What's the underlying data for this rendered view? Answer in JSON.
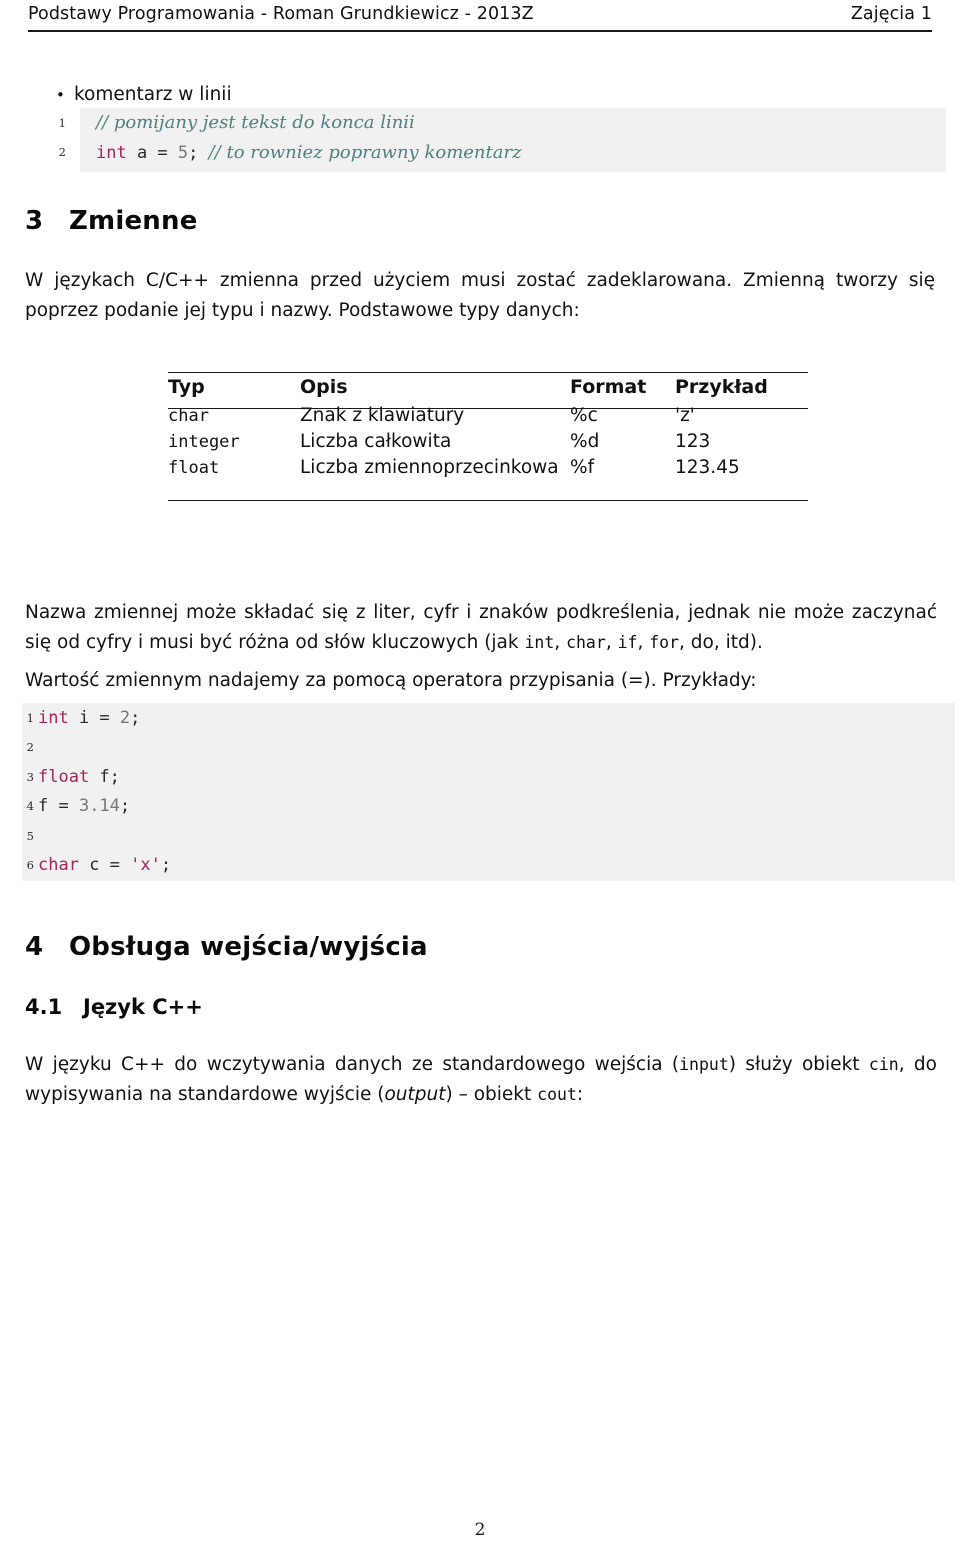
{
  "header": {
    "left": "Podstawy Programowania - Roman Grundkiewicz - 2013Z",
    "right": "Zajęcia 1"
  },
  "bullet": {
    "marker": "•",
    "text": "komentarz w linii"
  },
  "code_comments": {
    "lines": [
      {
        "no": "1",
        "tokens": [
          {
            "t": "// pomijany jest tekst do konca linii",
            "c": "cmt"
          }
        ]
      },
      {
        "no": "2",
        "tokens": [
          {
            "t": "int",
            "c": "kw"
          },
          {
            "t": " a = ",
            "c": "pln"
          },
          {
            "t": "5",
            "c": "num"
          },
          {
            "t": "; ",
            "c": "pln"
          },
          {
            "t": "// to rowniez poprawny komentarz",
            "c": "cmt"
          }
        ]
      }
    ]
  },
  "section_zmienne": {
    "number": "3",
    "title": "Zmienne",
    "paragraph_1": "W językach C/C++ zmienna przed użyciem musi zostać zadeklarowana. Zmienną tworzy się poprzez podanie jej typu i nazwy. Podstawowe typy danych:"
  },
  "types_table": {
    "columns": [
      "Typ",
      "Opis",
      "Format",
      "Przykład"
    ],
    "rows": [
      {
        "typ": "char",
        "opis": "Znak z klawiatury",
        "format": "%c",
        "przyklad": "'z'"
      },
      {
        "typ": "integer",
        "opis": "Liczba całkowita",
        "format": "%d",
        "przyklad": "123"
      },
      {
        "typ": "float",
        "opis": "Liczba zmiennoprzecinkowa",
        "format": "%f",
        "przyklad": "123.45"
      }
    ]
  },
  "paragraphs": {
    "nazwa_part1": "Nazwa zmiennej może składać się z liter, cyfr i znaków podkreślenia, jednak nie może zaczynać się od cyfry i musi być różna od słów kluczowych (jak ",
    "nazwa_kw1": "int",
    "nazwa_sep1": ", ",
    "nazwa_kw2": "char",
    "nazwa_sep2": ", ",
    "nazwa_kw3": "if",
    "nazwa_sep3": ", ",
    "nazwa_kw4": "for",
    "nazwa_part2": ", do, itd).",
    "przypisanie": "Wartość zmiennym nadajemy za pomocą operatora przypisania (=). Przykłady:"
  },
  "code_vars": {
    "lines": [
      {
        "no": "1",
        "tokens": [
          {
            "t": "int",
            "c": "kw"
          },
          {
            "t": " i = ",
            "c": "pln"
          },
          {
            "t": "2",
            "c": "num"
          },
          {
            "t": ";",
            "c": "pln"
          }
        ]
      },
      {
        "no": "2",
        "tokens": []
      },
      {
        "no": "3",
        "tokens": [
          {
            "t": "float",
            "c": "kw"
          },
          {
            "t": " f;",
            "c": "pln"
          }
        ]
      },
      {
        "no": "4",
        "tokens": [
          {
            "t": "f = ",
            "c": "pln"
          },
          {
            "t": "3.14",
            "c": "num"
          },
          {
            "t": ";",
            "c": "pln"
          }
        ]
      },
      {
        "no": "5",
        "tokens": []
      },
      {
        "no": "6",
        "tokens": [
          {
            "t": "char",
            "c": "kw"
          },
          {
            "t": " c = ",
            "c": "pln"
          },
          {
            "t": "'x'",
            "c": "str"
          },
          {
            "t": ";",
            "c": "pln"
          }
        ]
      }
    ]
  },
  "section_obsluga": {
    "number": "4",
    "title": "Obsługa wejścia/wyjścia"
  },
  "subsection_jezyk": {
    "number": "4.1",
    "title": "Język C++"
  },
  "cin_cout": {
    "part1": "W języku C++ do wczytywania danych ze standardowego wejścia (",
    "mono1": "input",
    "part2": ") służy obiekt ",
    "mono2": "cin",
    "part3": ", do wypisywania na standardowe wyjście (",
    "ital1": "output",
    "part4": ") – obiekt ",
    "mono3": "cout",
    "part5": ":"
  },
  "footer": {
    "page_number": "2"
  },
  "colors": {
    "keyword": "#a4255b",
    "comment": "#4e8080",
    "number": "#777777",
    "code_background": "#f1f1f1",
    "text": "#111111"
  }
}
